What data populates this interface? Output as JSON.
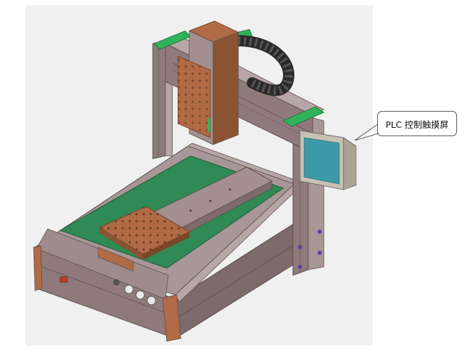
{
  "callout": {
    "label": "PLC 控制触摸屏"
  },
  "colors": {
    "frame": "#8e7a7a",
    "frame_dark": "#5e4f4f",
    "frame_light": "#b7a6a6",
    "plate": "#b06a45",
    "plate_dark": "#7a4528",
    "table_green": "#2f8a55",
    "bracket_green": "#2fb35a",
    "screen": "#3c9aa8",
    "cable_chain": "#2a2a2a",
    "button": "#e9e9e9",
    "switch_red": "#c0392b",
    "panel_bg": "#f0f0f0"
  },
  "icons": {
    "cable_chain": "cable-chain-icon",
    "touch_screen": "touch-screen-icon"
  }
}
